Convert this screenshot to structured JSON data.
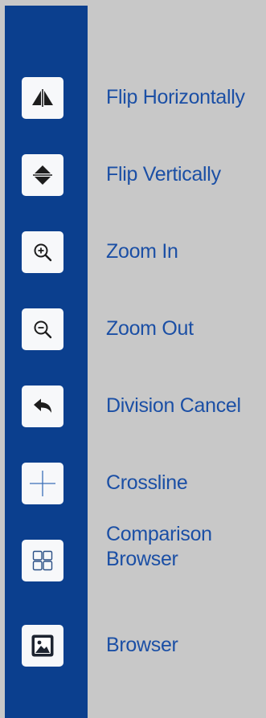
{
  "panel": {
    "accent_color": "#0b3f8e",
    "background_color": "#c8c8c8",
    "label_color": "#1b4fa5"
  },
  "tools": [
    {
      "icon": "flip-horizontal-icon",
      "label": "Flip Horizontally"
    },
    {
      "icon": "flip-vertical-icon",
      "label": "Flip Vertically"
    },
    {
      "icon": "zoom-in-icon",
      "label": "Zoom In"
    },
    {
      "icon": "zoom-out-icon",
      "label": "Zoom Out"
    },
    {
      "icon": "undo-arrow-icon",
      "label": "Division Cancel"
    },
    {
      "icon": "crossline-icon",
      "label": "Crossline"
    },
    {
      "icon": "grid-layout-icon",
      "label_line1": "Comparison",
      "label_line2": "Browser"
    },
    {
      "icon": "image-browser-icon",
      "label": "Browser"
    }
  ]
}
